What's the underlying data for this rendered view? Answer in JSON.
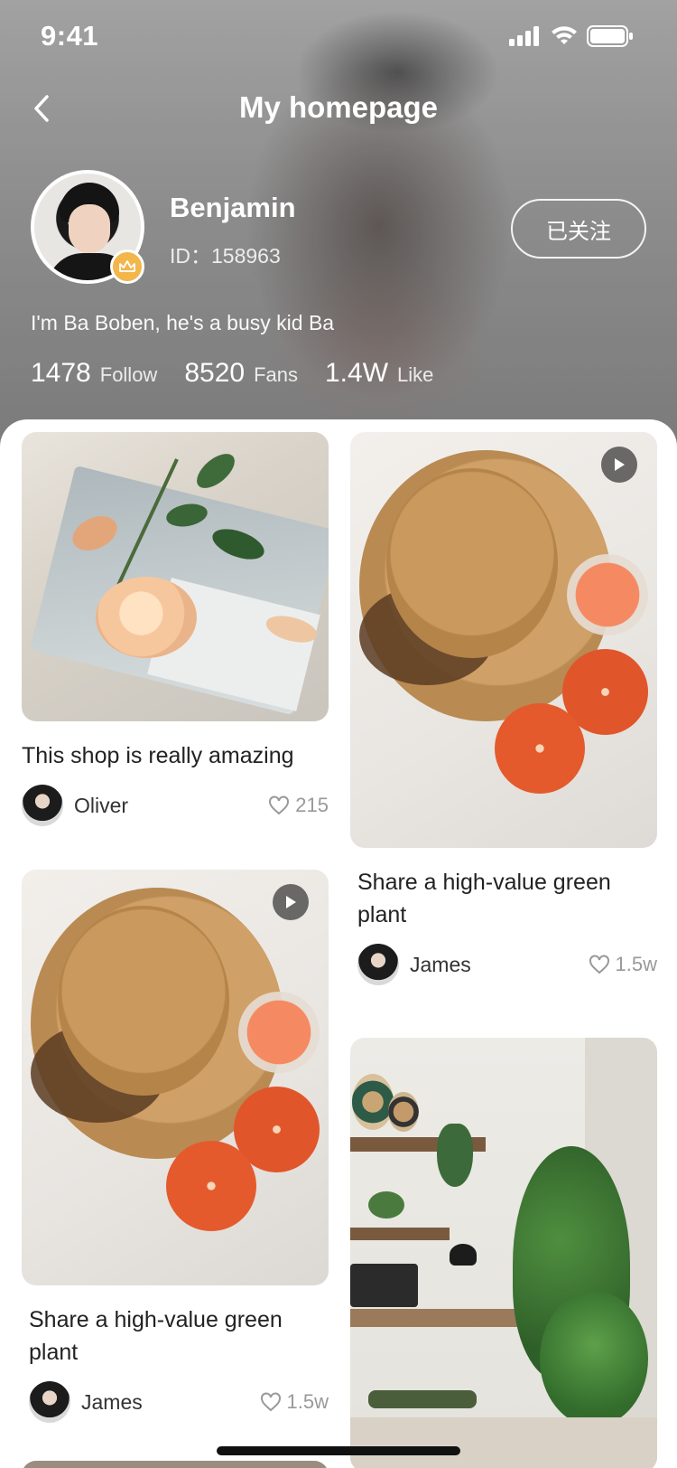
{
  "status_bar": {
    "time": "9:41"
  },
  "nav": {
    "title": "My homepage"
  },
  "profile": {
    "name": "Benjamin",
    "id_label": "ID：",
    "id_value": "158963",
    "follow_button": "已关注",
    "bio": "I'm Ba Boben, he's a busy kid Ba",
    "stats": [
      {
        "value": "1478",
        "label": "Follow"
      },
      {
        "value": "8520",
        "label": "Fans"
      },
      {
        "value": "1.4W",
        "label": "Like"
      }
    ]
  },
  "posts": [
    {
      "title": "This shop is really amazing",
      "author": "Oliver",
      "likes": "215",
      "video": false
    },
    {
      "title": "Share a high-value green plant",
      "author": "James",
      "likes": "1.5w",
      "video": true
    },
    {
      "title": "Share a high-value green plant",
      "author": "James",
      "likes": "1.5w",
      "video": true
    },
    {
      "title": "",
      "author": "",
      "likes": "",
      "video": false
    }
  ],
  "colors": {
    "accent_badge": "#f3b64a",
    "text_primary": "#222222",
    "text_muted": "#999999"
  }
}
